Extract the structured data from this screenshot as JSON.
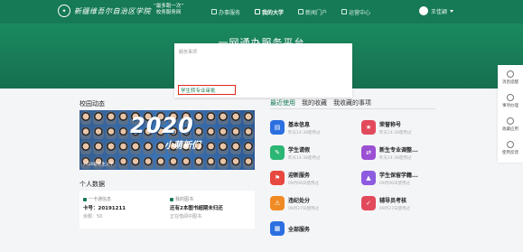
{
  "header": {
    "logo_text": "新疆维吾尔自治区学院",
    "slogan_line1": "“最多跑一次”",
    "slogan_line2": "校务服务网",
    "nav": [
      {
        "label": "办事服务"
      },
      {
        "label": "我的大学"
      },
      {
        "label": "新闻门户"
      },
      {
        "label": "运营中心"
      }
    ],
    "user_name": "王佳颖"
  },
  "hero": {
    "title": "一网通办服务平台",
    "search_value": "转专业",
    "search_button": "搜索"
  },
  "dropdown": {
    "header": "服务事项",
    "item": "学生转专业审批"
  },
  "left": {
    "campus_title": "校园动态",
    "banner_year": "2020",
    "banner_slogan": "小萌新们",
    "banner_caption": "2020级新生入学",
    "personal_title": "个人数据",
    "card1_label": "一卡通信息",
    "card1_value": "卡号：20191211",
    "card1_sub": "余额：50",
    "card2_label": "我的图书",
    "card2_value": "还有2本图书超期未归还",
    "card2_sub": "正在借阅中图书"
  },
  "right": {
    "tabs": [
      "最近使用",
      "我的收藏",
      "我收藏的事项"
    ],
    "services": [
      {
        "name": "基本信息",
        "sub": "昨天14:38使用过",
        "color": "#2c6fe0",
        "icon": "▤"
      },
      {
        "name": "荣誉称号",
        "sub": "昨天14:38使用过",
        "color": "#e24a5b",
        "icon": "★"
      },
      {
        "name": "学生请假",
        "sub": "昨天14:38使用过",
        "color": "#2bb673",
        "icon": "✎"
      },
      {
        "name": "新生专业调整...",
        "sub": "昨天14:38使用过",
        "color": "#9b4fd3",
        "icon": "⇄"
      },
      {
        "name": "迎新服务",
        "sub": "09月06日使用过",
        "color": "#e8483f",
        "icon": "⚑"
      },
      {
        "name": "学生保留学籍...",
        "sub": "09月06日使用过",
        "color": "#8d5be0",
        "icon": "▲"
      },
      {
        "name": "违纪处分",
        "sub": "09月27日使用过",
        "color": "#f08a24",
        "icon": "⚠"
      },
      {
        "name": "辅导员考核",
        "sub": "09月27日使用过",
        "color": "#e24a5b",
        "icon": "✓"
      },
      {
        "name": "全部服务",
        "sub": "",
        "color": "#2c6fe0",
        "icon": "▦"
      }
    ]
  },
  "float_bar": [
    {
      "label": "消息提醒"
    },
    {
      "label": "事项办理"
    },
    {
      "label": "收藏应用"
    },
    {
      "label": "使用反馈"
    }
  ]
}
